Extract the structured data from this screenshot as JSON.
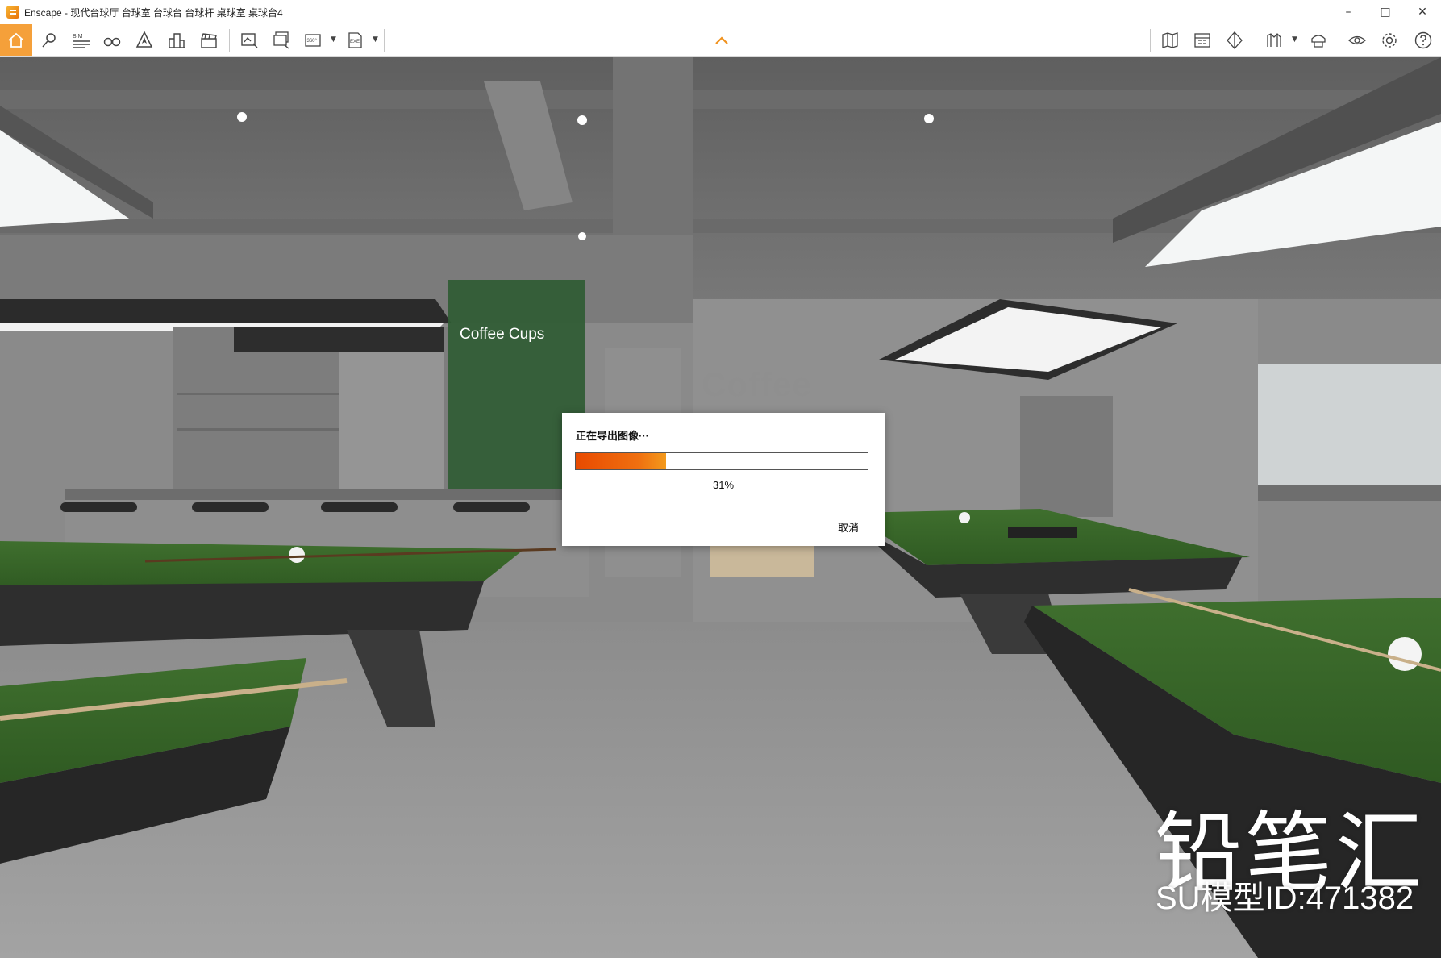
{
  "window": {
    "title": "Enscape - 现代台球厅 台球室 台球台 台球杆 桌球室 桌球台4",
    "controls": [
      "minimize",
      "maximize",
      "close"
    ]
  },
  "toolbar": {
    "left_icons": [
      "home-icon",
      "location-pin-icon",
      "bim-icon",
      "binoculars-icon",
      "north-compass-icon",
      "buildings-icon",
      "clapperboard-icon",
      "export-image-icon",
      "batch-render-icon",
      "panorama-360-icon",
      "export-exe-icon"
    ],
    "bim_label": "BIM",
    "pano_label": "360°",
    "exe_label": "EXE",
    "right_icons": [
      "map-icon",
      "asset-library-icon",
      "view-cube-icon",
      "material-icon",
      "feedback-icon",
      "visibility-icon",
      "settings-icon",
      "help-icon"
    ]
  },
  "scene": {
    "sign_text": "Coffee Cups",
    "wall_logo": "Coffee",
    "watermark": "铅笔汇",
    "model_id": "SU模型ID:471382"
  },
  "dialog": {
    "title": "正在导出图像···",
    "progress": 0.31,
    "progress_label": "31%",
    "cancel_label": "取消"
  }
}
